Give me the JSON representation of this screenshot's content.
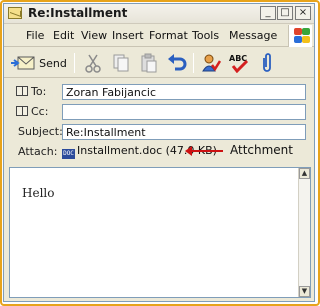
{
  "window": {
    "title": "Re:Installment",
    "controls": {
      "minimize": "_",
      "maximize": "□",
      "close": "×"
    }
  },
  "menu": [
    "File",
    "Edit",
    "View",
    "Insert",
    "Format",
    "Tools",
    "Message"
  ],
  "toolbar": {
    "send_label": "Send",
    "icons": [
      "send-icon",
      "cut-icon",
      "copy-icon",
      "paste-icon",
      "undo-icon",
      "check-names-icon",
      "spelling-icon",
      "attach-icon"
    ]
  },
  "header": {
    "to_label": "To:",
    "to_value": "Zoran Fabijancic",
    "cc_label": "Cc:",
    "cc_value": "",
    "subject_label": "Subject:",
    "subject_value": "Re:Installment",
    "attach_label": "Attach:",
    "attachment": "Installment.doc (47.0 KB)"
  },
  "annotation": {
    "text": "Attchment",
    "color": "#cc1111"
  },
  "body": {
    "text": "Hello"
  },
  "colors": {
    "frame_accent": "#e7a31b",
    "window_bg": "#ece9d8",
    "field_border": "#7f9db9"
  }
}
